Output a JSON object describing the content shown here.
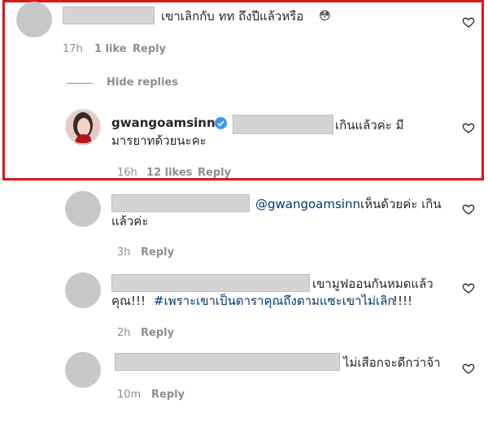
{
  "comments": [
    {
      "text": "เขาเลิกกับ ทท ถึงปีแล้วหรือ",
      "emoji": "😳",
      "time": "17h",
      "likes": "1 like",
      "reply": "Reply"
    },
    {
      "username": "gwangoamsinn",
      "text_line1": "เกินแล้วค่ะ มี",
      "text_line2": "มารยาทด้วยนะคะ",
      "time": "16h",
      "likes": "12 likes",
      "reply": "Reply"
    },
    {
      "mention": "@gwangoamsinn",
      "text_line1": "เห็นด้วยค่ะ เกิน",
      "text_line2": "แล้วค่ะ",
      "time": "3h",
      "reply": "Reply"
    },
    {
      "text_line1": "เขามูฟออนกันหมดแล้ว",
      "text_line2_prefix": "คุณ!!!",
      "hashtag": "#เพราะเขาเป็นดาราคุณถึงตามแซะเขาไม่เลิก",
      "text_line2_suffix": "!!!!",
      "time": "2h",
      "reply": "Reply"
    },
    {
      "text": "ไม่เสือกจะดีกว่าจ้า",
      "time": "10m",
      "reply": "Reply"
    }
  ],
  "hide_replies": "Hide replies",
  "colors": {
    "highlight_border": "#d9161c",
    "verified": "#3897f0",
    "meta": "#8e8e8e",
    "link": "#00376b"
  }
}
